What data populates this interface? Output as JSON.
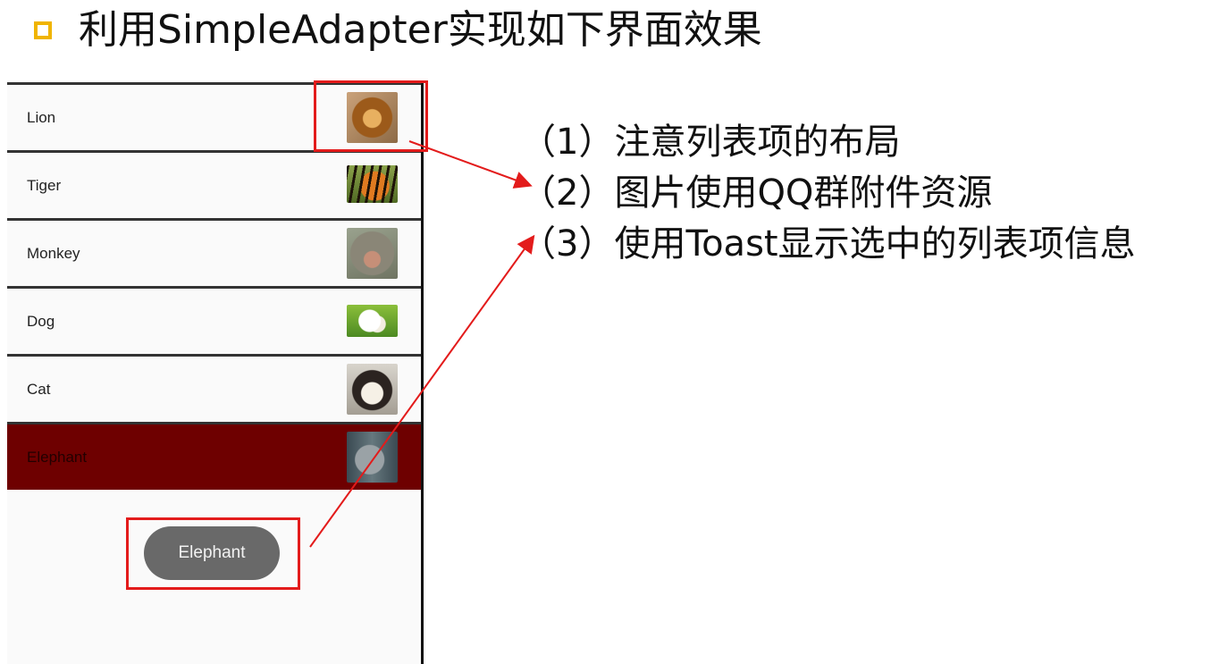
{
  "title": {
    "bullet_icon": "hollow-square-bullet",
    "text": "利用SimpleAdapter实现如下界面效果"
  },
  "list": {
    "items": [
      {
        "label": "Lion",
        "image": "lion"
      },
      {
        "label": "Tiger",
        "image": "tiger"
      },
      {
        "label": "Monkey",
        "image": "monkey"
      },
      {
        "label": "Dog",
        "image": "dog"
      },
      {
        "label": "Cat",
        "image": "cat"
      },
      {
        "label": "Elephant",
        "image": "elephant",
        "selected": true
      }
    ],
    "selected_color": "#6e0000"
  },
  "toast": {
    "text": "Elephant"
  },
  "notes": [
    "（1）注意列表项的布局",
    "（2）图片使用QQ群附件资源",
    "（3）使用Toast显示选中的列表项信息"
  ],
  "colors": {
    "highlight": "#e31b1b",
    "bullet": "#F0B400",
    "toast_bg": "#696969"
  }
}
